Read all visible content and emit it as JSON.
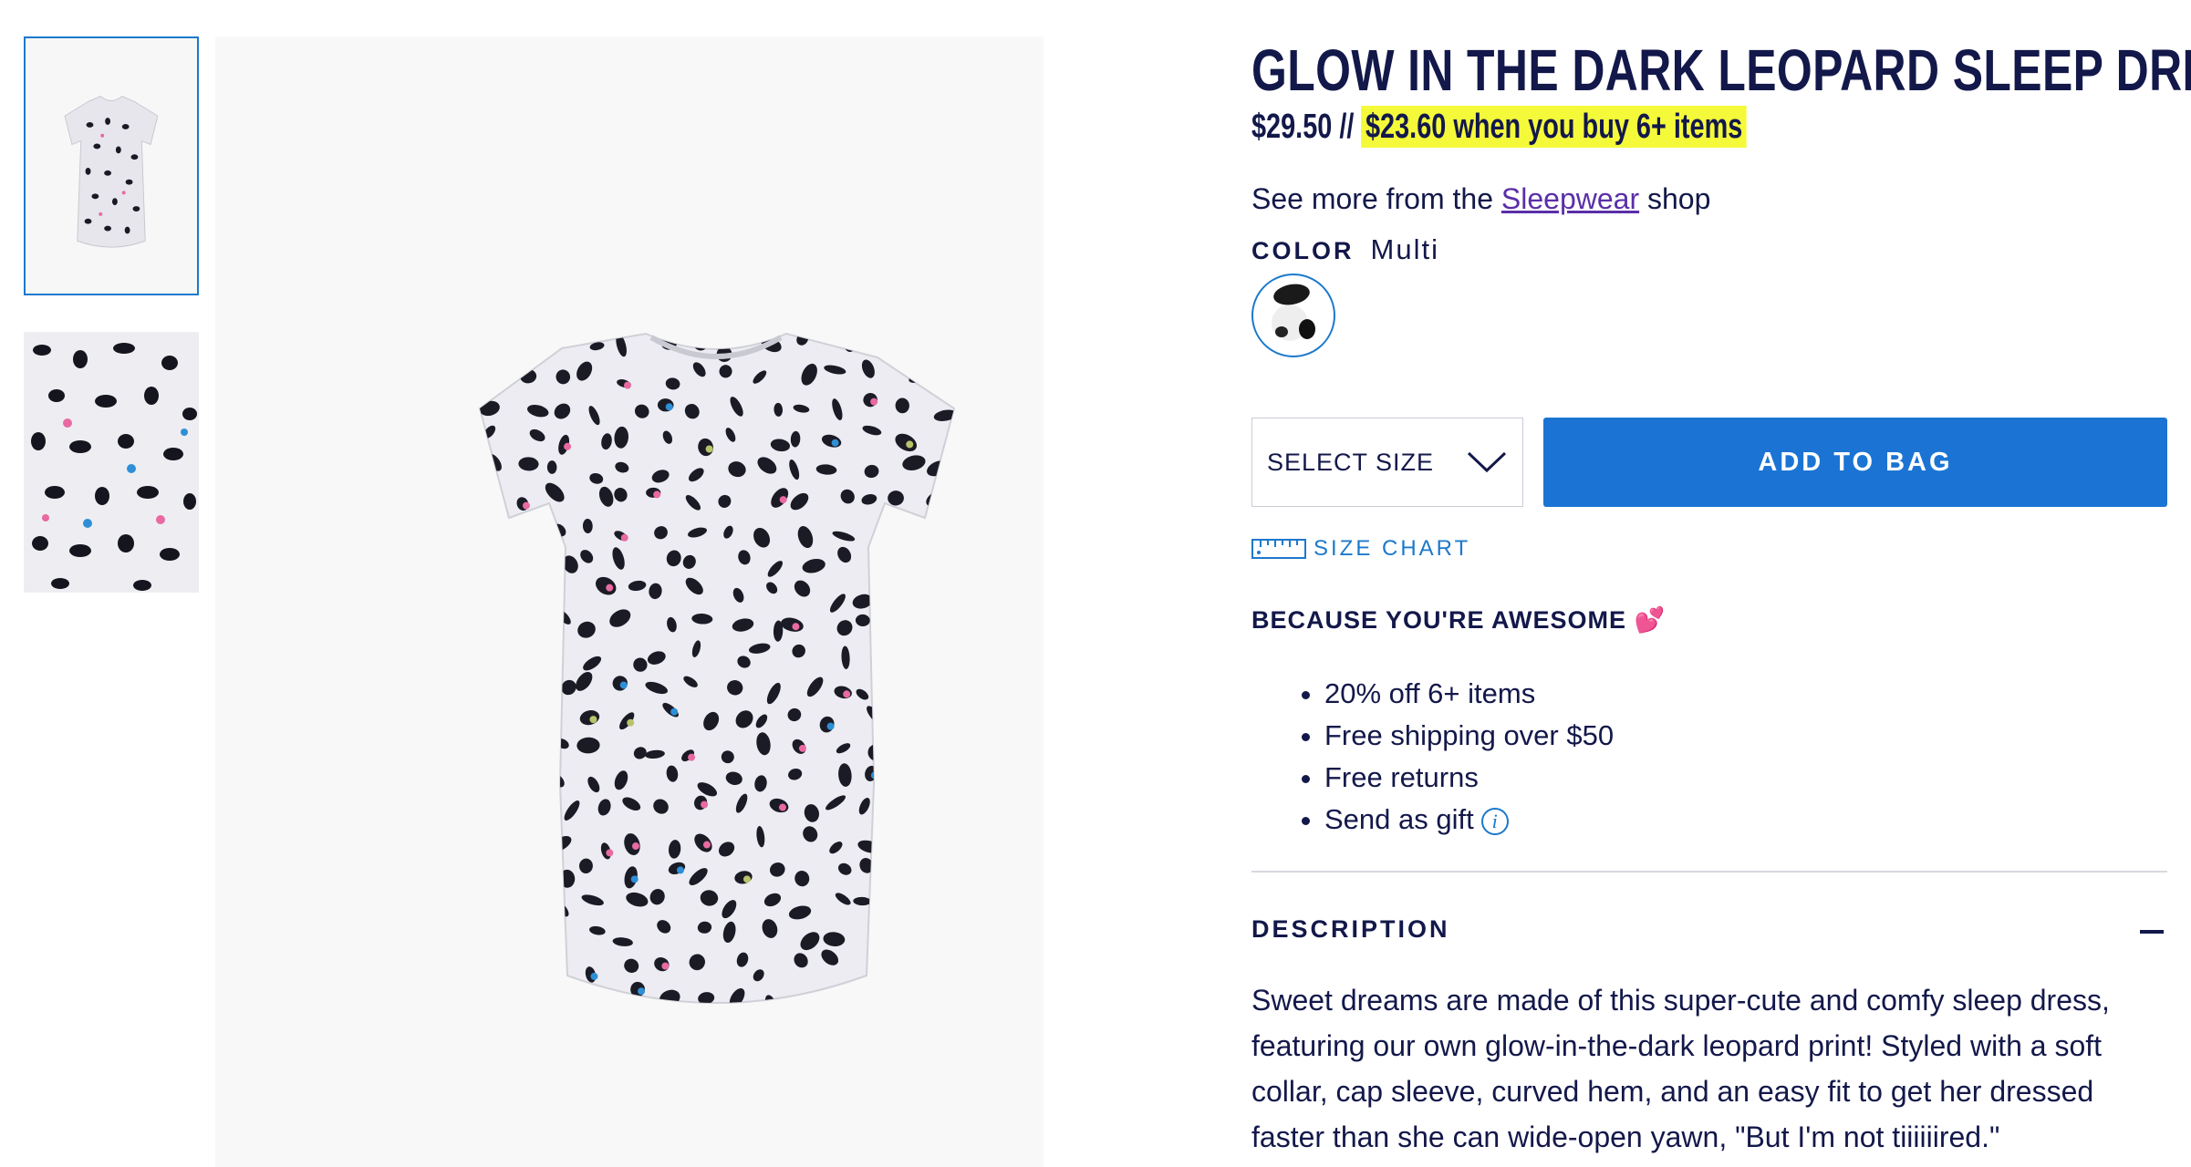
{
  "product": {
    "title": "GLOW IN THE DARK LEOPARD SLEEP DRESS",
    "price": "$29.50",
    "price_sep": " // ",
    "bulk_offer": "$23.60 when you buy 6+ items",
    "highlight_color": "#f4fa3a"
  },
  "shop_line": {
    "prefix": "See more from the ",
    "link": "Sleepwear",
    "suffix": " shop"
  },
  "color": {
    "label": "COLOR",
    "value": "Multi"
  },
  "size_select": {
    "label": "SELECT SIZE"
  },
  "add_to_bag": {
    "label": "ADD TO BAG",
    "color": "#1b74d4"
  },
  "size_chart": {
    "label": "SIZE CHART",
    "icon": "ruler-icon"
  },
  "awesome": {
    "heading": "BECAUSE YOU'RE AWESOME",
    "emoji": "💕",
    "perks": [
      "20% off 6+ items",
      "Free shipping over $50",
      "Free returns",
      "Send as gift"
    ]
  },
  "description": {
    "heading": "DESCRIPTION",
    "toggle_icon": "minus-icon",
    "body": "Sweet dreams are made of this super-cute and comfy sleep dress, featuring our own glow-in-the-dark leopard print! Styled with a soft collar, cap sleeve, curved hem, and an easy fit to get her dressed faster than she can wide-open yawn, \"But I'm not tiiiiiired.\""
  },
  "gallery": {
    "thumbnails": [
      "dress-thumbnail",
      "print-closeup-thumbnail"
    ]
  }
}
